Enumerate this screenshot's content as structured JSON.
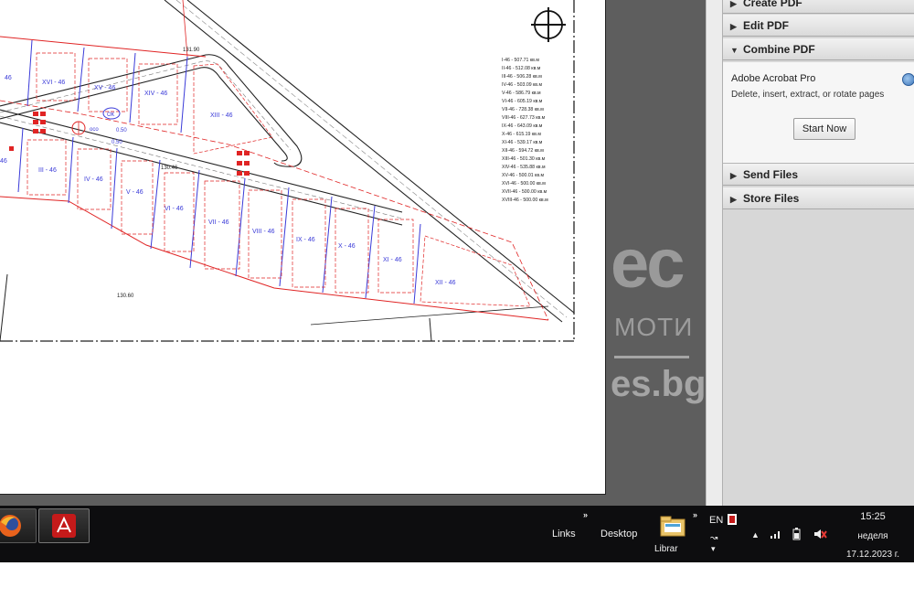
{
  "plan": {
    "legend": [
      "I-46 - 507.71 кв.м",
      "II-46 - 512.08 кв.м",
      "III-46 - 506.28 кв.м",
      "IV-46 - 503.09 кв.м",
      "V-46 - 586.79 кв.м",
      "VI-46 - 605.19 кв.м",
      "VII-46 - 728.38 кв.м",
      "VIII-46 - 627.73 кв.м",
      "IX-46 - 643.09 кв.м",
      "X-46 - 615.19 кв.м",
      "XI-46 - 539.17 кв.м",
      "XII-46 - 594.72 кв.м",
      "XIII-46 - 501.30 кв.м",
      "XIV-46 - 535.88 кв.м",
      "XV-46 - 500.01 кв.м",
      "XVI-46 - 500.00 кв.м",
      "XVII-46 - 500.00 кв.м",
      "XVIII-46 - 500.00 кв.м"
    ],
    "top_lots": [
      "XVI - 46",
      "XV - 46",
      "XIV - 46",
      "XIII - 46"
    ],
    "top_lot_partial": "46",
    "bottom_lots": [
      "III - 46",
      "IV - 46",
      "V - 46",
      "VI - 46",
      "VII - 46",
      "VIII - 46",
      "IX - 46",
      "X - 46",
      "XI - 46",
      "XII - 46"
    ],
    "bottom_lot_partial": "46",
    "elevation_top": "131.90",
    "elevation_mid": "130.46",
    "elevation_bottom": "130.60",
    "road_badge": "ОК",
    "road_label_1": "осо",
    "road_label_2": "0.50",
    "road_label_3": "0.50"
  },
  "watermark": {
    "big": "ес",
    "mid": "МОТИ",
    "url": "es.bg"
  },
  "tasks": {
    "create_pdf": "Create PDF",
    "edit_pdf": "Edit PDF",
    "combine_pdf": "Combine PDF",
    "combine_title": "Adobe Acrobat Pro",
    "combine_desc": "Delete, insert, extract, or rotate pages",
    "start_now": "Start Now",
    "send_files": "Send Files",
    "store_files": "Store Files"
  },
  "taskbar": {
    "links": "Links",
    "desktop": "Desktop",
    "libraries": "Librar",
    "lang": "EN",
    "time": "15:25",
    "day": "неделя",
    "date": "17.12.2023 г."
  },
  "colors": {
    "lot_blue": "#3a3ad8",
    "plan_red": "#e02424",
    "taskbar": "#0d0d0f"
  }
}
